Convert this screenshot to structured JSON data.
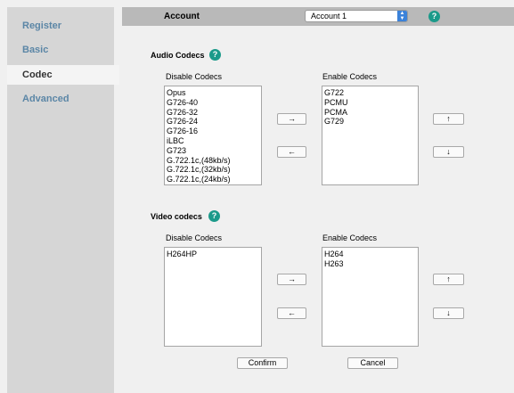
{
  "sidebar": {
    "items": [
      {
        "label": "Register"
      },
      {
        "label": "Basic"
      },
      {
        "label": "Codec"
      },
      {
        "label": "Advanced"
      }
    ]
  },
  "header": {
    "account_label": "Account",
    "account_value": "Account 1",
    "help": "?"
  },
  "audio": {
    "title": "Audio Codecs",
    "disable_label": "Disable Codecs",
    "enable_label": "Enable Codecs",
    "disabled": [
      "Opus",
      "G726-40",
      "G726-32",
      "G726-24",
      "G726-16",
      "iLBC",
      "G723",
      "G.722.1c,(48kb/s)",
      "G.722.1c,(32kb/s)",
      "G.722.1c,(24kb/s)"
    ],
    "enabled": [
      "G722",
      "PCMU",
      "PCMA",
      "G729"
    ]
  },
  "video": {
    "title": "Video codecs",
    "disable_label": "Disable Codecs",
    "enable_label": "Enable Codecs",
    "disabled": [
      "H264HP"
    ],
    "enabled": [
      "H264",
      "H263"
    ]
  },
  "buttons": {
    "move_right": "→",
    "move_left": "←",
    "move_up": "↑",
    "move_down": "↓",
    "confirm": "Confirm",
    "cancel": "Cancel"
  }
}
